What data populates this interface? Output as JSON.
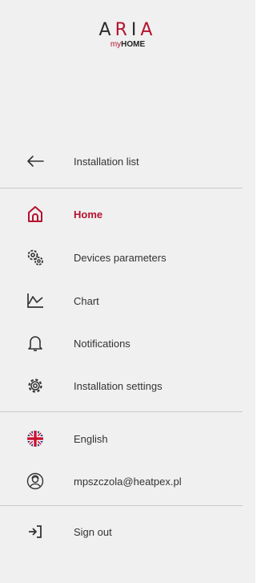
{
  "brand": {
    "logo_prefix": "A",
    "logo_accent_one": "R",
    "logo_mid": "I",
    "logo_accent_two": "A",
    "sub_my": "my",
    "sub_home": "HOME"
  },
  "colors": {
    "accent": "#b5122e",
    "background": "#f0f0f0",
    "text": "#333333"
  },
  "menu": {
    "back": {
      "label": "Installation list",
      "icon": "arrow-left-icon"
    },
    "items": [
      {
        "label": "Home",
        "icon": "home-icon",
        "active": true
      },
      {
        "label": "Devices parameters",
        "icon": "gears-icon",
        "active": false
      },
      {
        "label": "Chart",
        "icon": "chart-line-icon",
        "active": false
      },
      {
        "label": "Notifications",
        "icon": "bell-icon",
        "active": false
      },
      {
        "label": "Installation settings",
        "icon": "gear-icon",
        "active": false
      }
    ],
    "language": {
      "label": "English",
      "icon": "uk-flag-icon"
    },
    "account": {
      "label": "mpszczola@heatpex.pl",
      "icon": "user-avatar-icon"
    },
    "signout": {
      "label": "Sign out",
      "icon": "sign-out-icon"
    }
  }
}
